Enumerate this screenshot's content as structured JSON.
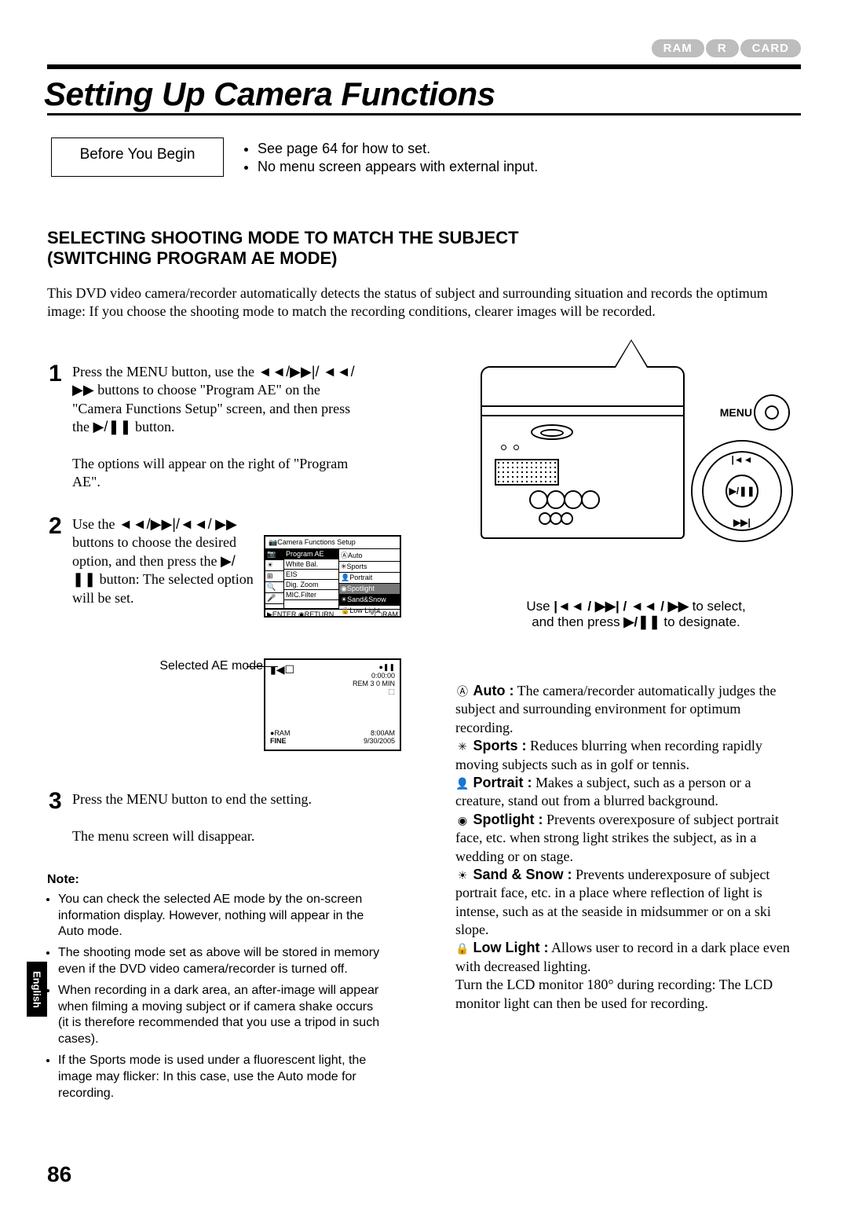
{
  "media_labels": [
    "RAM",
    "R",
    "CARD"
  ],
  "title": "Setting Up Camera Functions",
  "before_box": "Before You Begin",
  "before_bullets": [
    "See page 64 for how to set.",
    "No menu screen appears with external input."
  ],
  "section_heading_line1": "SELECTING SHOOTING MODE TO MATCH THE SUBJECT",
  "section_heading_line2": "(SWITCHING PROGRAM AE MODE)",
  "intro": "This DVD video camera/recorder automatically detects the status of subject and surrounding situation and records the optimum image: If you choose the shooting mode to match the recording conditions, clearer images will be recorded.",
  "step1": {
    "num": "1",
    "p1a": "Press the MENU button, use the ",
    "sym1": "◄◄/▶▶|/",
    "sym2": "◄◄/▶▶",
    "p1b": " buttons to choose \"Program AE\" on the \"Camera Functions Setup\" screen, and then press the ",
    "sym3": "▶/❚❚",
    "p1c": " button.",
    "p2": "The options will appear on the right of \"Program AE\"."
  },
  "step2": {
    "num": "2",
    "a": "Use the ",
    "sym1": "◄◄/▶▶|/◄◄/",
    "sym2": "▶▶",
    "b": " buttons to choose the desired option, and then press the ",
    "sym3": "▶/❚❚",
    "c": " button: The selected option will be set."
  },
  "step3": {
    "num": "3",
    "p1": "Press the MENU button to end the setting.",
    "p2": "The menu screen will disappear."
  },
  "note": {
    "label": "Note:",
    "items": [
      "You can check the selected AE mode by the on-screen information display. However, nothing will appear in the Auto mode.",
      "The shooting mode set as above will be stored in memory even if the DVD video camera/recorder is turned off.",
      "When recording in a dark area, an after-image will appear when filming a moving subject or if camera shake occurs (it is therefore recommended that you use a tripod in such cases).",
      "If the Sports mode is used under a fluorescent light, the image may flicker: In this case, use the Auto mode for recording."
    ]
  },
  "menu_screen": {
    "header": "Camera Functions Setup",
    "mains": [
      "Program AE",
      "White Bal.",
      "EIS",
      "Dig. Zoom",
      "MIC.Filter"
    ],
    "subs": [
      "Auto",
      "Sports",
      "Portrait",
      "Spotlight",
      "Sand&Snow",
      "Low Light"
    ],
    "footer_enter": "ENTER",
    "footer_return": "RETURN",
    "footer_ram": "RAM"
  },
  "ae_label": "Selected AE mode",
  "osd": {
    "topleft": "▮◀☐",
    "rec": "●❚❚",
    "time": "0:00:00",
    "rem": "REM 3 0 MIN",
    "ram": "RAM",
    "fine": "FINE",
    "clock": "8:00AM",
    "date": "9/30/2005"
  },
  "diagram": {
    "menu_label": "MENU",
    "center": "▶/❚❚",
    "top_sym": "|◄◄",
    "bot_sym": "▶▶|",
    "caption1": "Use ",
    "caption_syms": "|◄◄ / ▶▶| / ◄◄ / ▶▶",
    "caption2": " to select,",
    "caption3": "and then press ",
    "caption3_sym": "▶/❚❚",
    "caption4": " to designate."
  },
  "modes": {
    "auto": {
      "icon": "Ⓐ",
      "name": "Auto :",
      "text": " The camera/recorder automatically judges the subject and surrounding environment for optimum recording."
    },
    "sports": {
      "icon": "✳",
      "name": "Sports :",
      "text": " Reduces blurring when recording rapidly moving subjects such as in golf or tennis."
    },
    "portrait": {
      "icon": "👤",
      "name": "Portrait :",
      "text": " Makes a subject, such as a person or a creature, stand out from a blurred background."
    },
    "spotlight": {
      "icon": "◉",
      "name": "Spotlight :",
      "text": " Prevents overexposure of subject portrait face, etc. when strong light strikes the subject, as in a wedding or on stage."
    },
    "sandsnow": {
      "icon": "☀",
      "name": "Sand & Snow :",
      "text": " Prevents underexposure of subject portrait face, etc. in a place where reflection of light is intense, such as at the seaside in midsummer or on a ski slope."
    },
    "lowlight": {
      "icon": "🔒",
      "name": "Low Light :",
      "text": " Allows user to record in a dark place even with decreased lighting."
    },
    "tail": "Turn the LCD monitor 180° during recording: The LCD monitor light can then be used for recording."
  },
  "lang": "English",
  "page": "86"
}
